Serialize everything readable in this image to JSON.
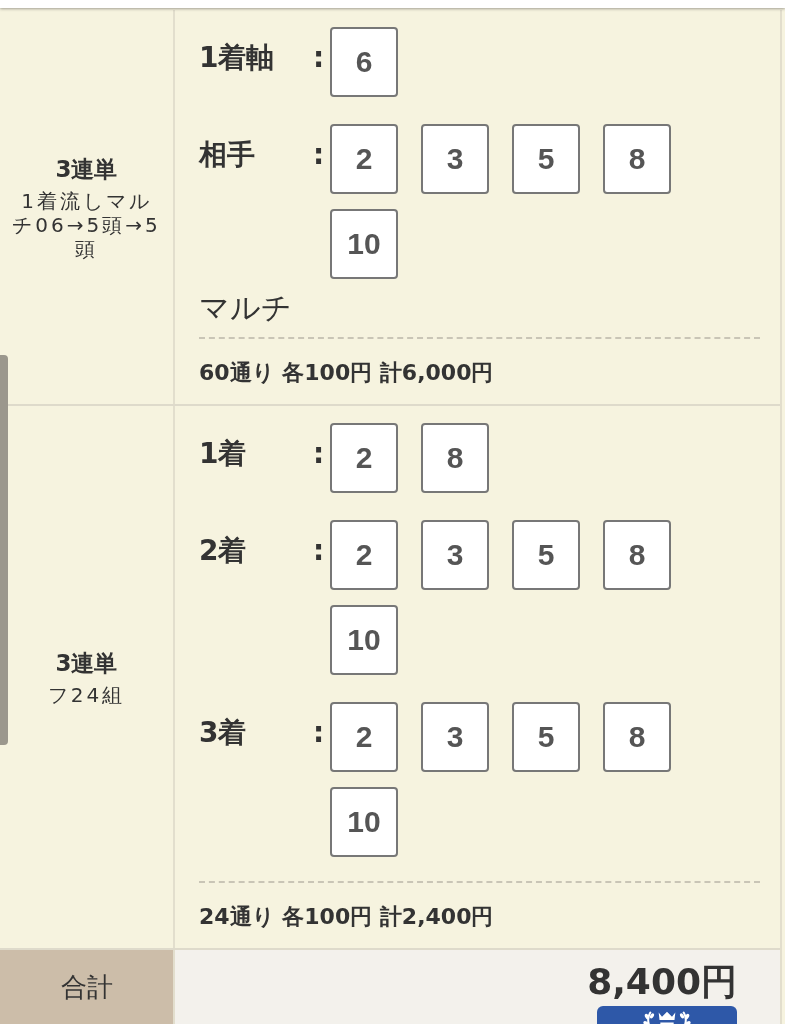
{
  "bets": [
    {
      "type": "3連単",
      "detail": "1着流しマルチ06→5頭→5頭",
      "positions": [
        {
          "label": "1着軸",
          "separator": ":",
          "numbers": [
            "6"
          ]
        },
        {
          "label": "相手",
          "separator": ":",
          "numbers": [
            "2",
            "3",
            "5",
            "8",
            "10"
          ]
        }
      ],
      "note": "マルチ",
      "summary": "60通り 各100円 計6,000円"
    },
    {
      "type": "3連単",
      "detail": "フ24組",
      "positions": [
        {
          "label": "1着",
          "separator": ":",
          "numbers": [
            "2",
            "8"
          ]
        },
        {
          "label": "2着",
          "separator": ":",
          "numbers": [
            "2",
            "3",
            "5",
            "8",
            "10"
          ]
        },
        {
          "label": "3着",
          "separator": ":",
          "numbers": [
            "2",
            "3",
            "5",
            "8",
            "10"
          ]
        }
      ],
      "summary": "24通り 各100円 計2,400円"
    }
  ],
  "total": {
    "label": "合計",
    "amount": "8,400円"
  }
}
